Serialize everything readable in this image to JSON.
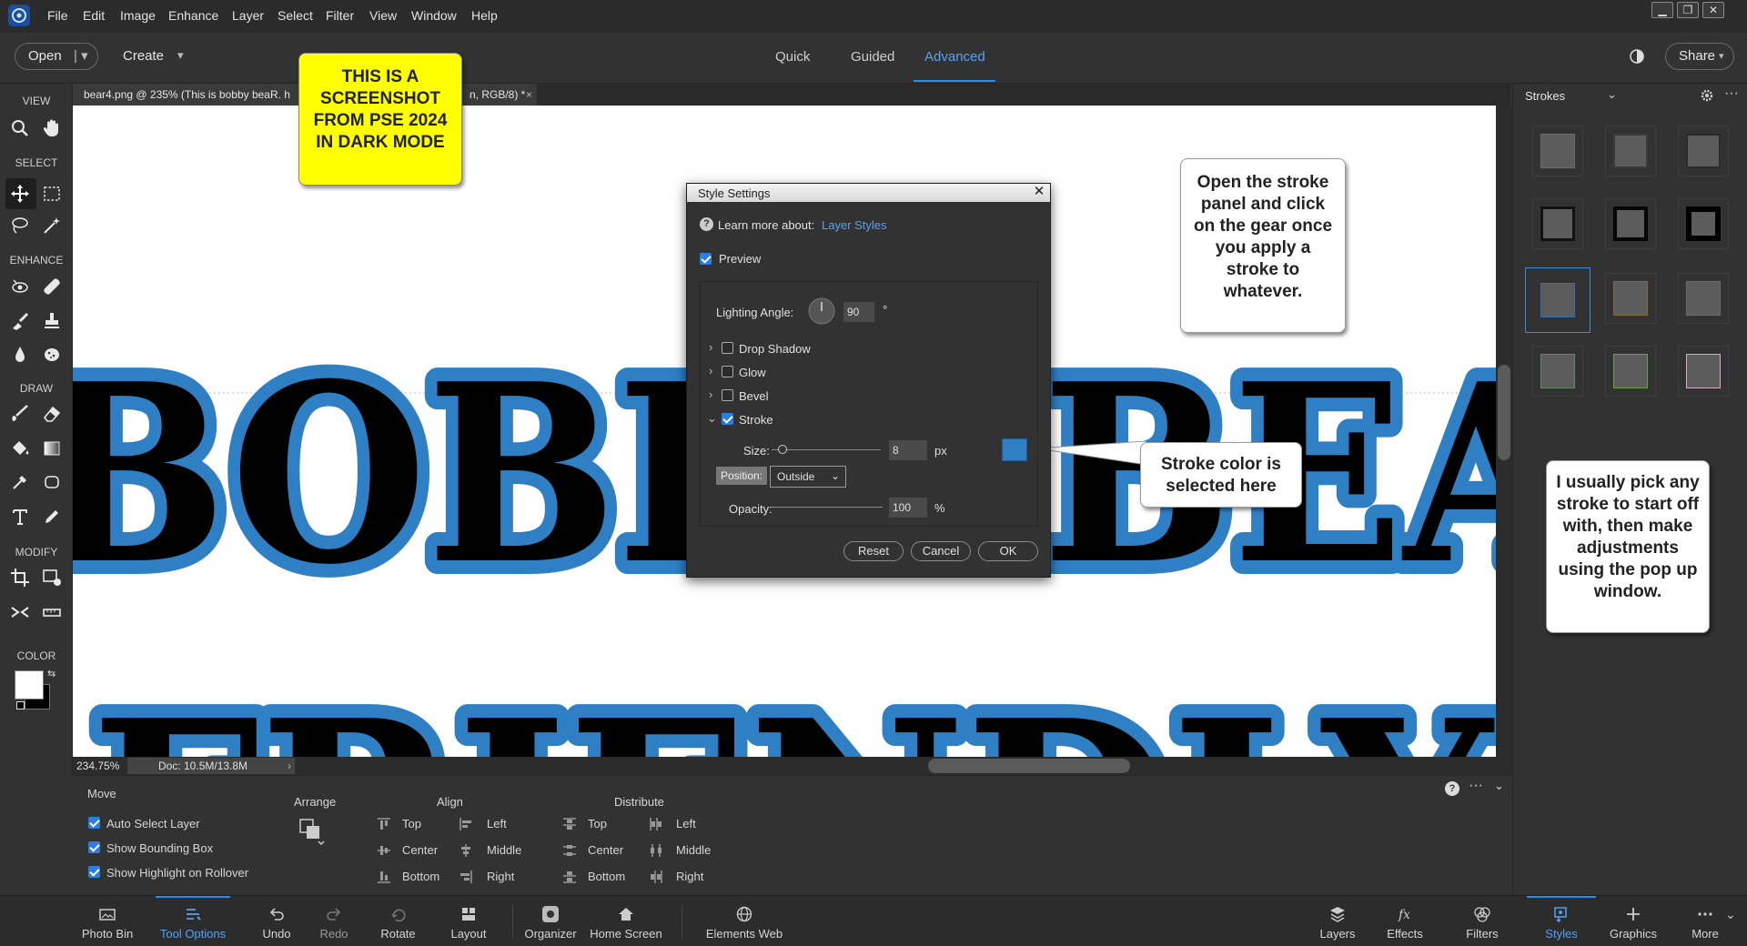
{
  "menubar": {
    "items": [
      "File",
      "Edit",
      "Image",
      "Enhance",
      "Layer",
      "Select",
      "Filter",
      "View",
      "Window",
      "Help"
    ]
  },
  "topbar": {
    "open_label": "Open",
    "create_label": "Create",
    "modes": [
      "Quick",
      "Guided",
      "Advanced"
    ],
    "share_label": "Share"
  },
  "document": {
    "tab_title": "bear4.png @ 235% (This is bobby beaR. h",
    "tab_title_tail": "n, RGB/8) *",
    "zoom": "234.75%",
    "doc_size": "Doc: 10.5M/13.8M"
  },
  "canvas_text": {
    "line1": "BOBBY BEAR",
    "line2": "FRIENDLY"
  },
  "toolbox": {
    "sections": [
      "VIEW",
      "SELECT",
      "ENHANCE",
      "DRAW",
      "MODIFY",
      "COLOR"
    ]
  },
  "callouts": {
    "yellow_note": "THIS IS A SCREENSHOT FROM PSE 2024 IN DARK MODE",
    "gear_tip": "Open the stroke panel and click on the gear once you apply a stroke to whatever.",
    "stroke_color_tip": "Stroke color is selected here",
    "pick_tip": "I usually pick any stroke to start off with, then make adjustments using the pop up window."
  },
  "dialog": {
    "title": "Style Settings",
    "learn_more": "Learn more about:",
    "learn_link": "Layer Styles",
    "preview": "Preview",
    "lighting_angle_label": "Lighting Angle:",
    "lighting_angle": "90",
    "degree": "°",
    "sections": [
      {
        "label": "Drop Shadow",
        "checked": false
      },
      {
        "label": "Glow",
        "checked": false
      },
      {
        "label": "Bevel",
        "checked": false
      },
      {
        "label": "Stroke",
        "checked": true
      }
    ],
    "size_label": "Size:",
    "size_value": "8",
    "size_unit": "px",
    "position_label": "Position:",
    "position_value": "Outside",
    "opacity_label": "Opacity:",
    "opacity_value": "100",
    "opacity_unit": "%",
    "stroke_color": "#2f7fc4",
    "buttons": {
      "reset": "Reset",
      "cancel": "Cancel",
      "ok": "OK"
    }
  },
  "right_panel": {
    "title": "Strokes"
  },
  "tool_options": {
    "tool_name": "Move",
    "checkboxes": [
      "Auto Select Layer",
      "Show Bounding Box",
      "Show Highlight on Rollover"
    ],
    "arrange_label": "Arrange",
    "align_label": "Align",
    "distribute_label": "Distribute",
    "align_col1": [
      "Top",
      "Center",
      "Bottom"
    ],
    "align_col2": [
      "Left",
      "Middle",
      "Right"
    ],
    "dist_col1": [
      "Top",
      "Center",
      "Bottom"
    ],
    "dist_col2": [
      "Left",
      "Middle",
      "Right"
    ]
  },
  "taskbar": {
    "left": [
      "Photo Bin",
      "Tool Options",
      "Undo",
      "Redo",
      "Rotate",
      "Layout",
      "Organizer",
      "Home Screen",
      "Elements Web"
    ],
    "right": [
      "Layers",
      "Effects",
      "Filters",
      "Styles",
      "Graphics",
      "More"
    ]
  },
  "colors": {
    "accent": "#2d8ceb",
    "stroke_blue": "#2f7fc4"
  }
}
